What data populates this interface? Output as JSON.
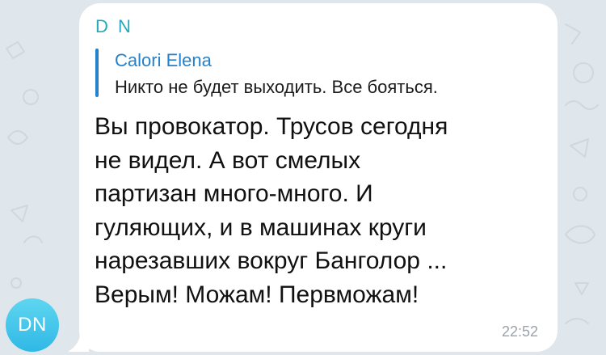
{
  "chat": {
    "background_color": "#dfe6ec",
    "avatar": {
      "initials": "DN",
      "gradient_top": "#5fd6f0",
      "gradient_bottom": "#2fb8e6"
    },
    "message": {
      "sender_name": "D N",
      "sender_color": "#25a9c2",
      "reply": {
        "author": "Calori Elena",
        "text": "Никто не будет выходить. Все бояться.",
        "accent_color": "#2481cc"
      },
      "text": "Вы провокатор. Трусов сегодня\nне видел. А вот смелых\nпартизан   много-много. И\nгуляющих, и в машинах круги\nнарезавших вокруг Банголор ...\nВерым! Можам! Первможам!",
      "time": "22:52"
    }
  }
}
